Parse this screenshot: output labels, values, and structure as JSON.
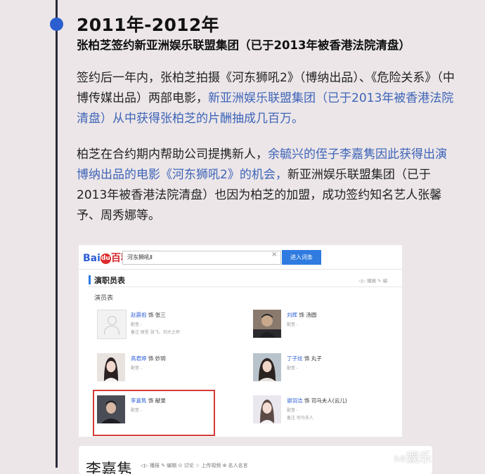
{
  "heading": {
    "year": "2011年-2012年",
    "subtitle": "张柏芝签约新亚洲娱乐联盟集团（已于2013年被香港法院清盘）"
  },
  "para1": {
    "text": "签约后一年内，张柏芝拍摄《河东狮吼2》（博纳出品）、《危险关系》（中博传媒出品）两部电影，",
    "highlight": "新亚洲娱乐联盟集团（已于2013年被香港法院清盘）从中获得张柏芝的片酬抽成几百万。"
  },
  "para2": {
    "text_before": "柏芝在合约期内帮助公司提携新人，",
    "highlight": "余毓兴的侄子李嘉隽因此获得出演博纳出品的电影《河东狮吼2》的机会，",
    "text_after": "新亚洲娱乐联盟集团（已于2013年被香港法院清盘）也因为柏芝的加盟，成功签约知名艺人张馨予、周秀娜等。"
  },
  "baidu": {
    "logo_bai": "Bai",
    "logo_du": "du",
    "logo_baike": "百科",
    "search_value": "河东狮吼Ⅱ",
    "clear": "×",
    "enter_button": "进入词条",
    "section_title": "演职员表",
    "section_actions": "◁▷ 播报    ✎ 编",
    "actor_tab": "演员表",
    "actors": [
      {
        "name": "赵震祖",
        "role_prefix": "饰",
        "role": "张三",
        "dub": "配音 -",
        "note": "备注  原型 张飞、刘大之师"
      },
      {
        "name": "刘辉",
        "role_prefix": "饰",
        "role": "汤圆",
        "dub": "配音 -",
        "note": ""
      },
      {
        "name": "高君婷",
        "role_prefix": "饰",
        "role": "妙玥",
        "dub": "配音 -",
        "note": ""
      },
      {
        "name": "丁子炫",
        "role_prefix": "饰",
        "role": "丸子",
        "dub": "配音 -",
        "note": ""
      },
      {
        "name": "李嘉隽",
        "role_prefix": "饰",
        "role": "献录",
        "dub": "配音 -",
        "note": ""
      },
      {
        "name": "谢羽洁",
        "role_prefix": "饰",
        "role": "司马夫人(云儿)",
        "dub": "配音 -",
        "note": "备注  司马夫人"
      }
    ]
  },
  "card2": {
    "title": "李嘉隽",
    "actions": "◁▷ 播报   ✎ 编辑   ⊙ 讨论   ☆ 上传视频   ⊕ 名人名言"
  },
  "watermark": {
    "small": "头条",
    "main": "娱乐"
  }
}
